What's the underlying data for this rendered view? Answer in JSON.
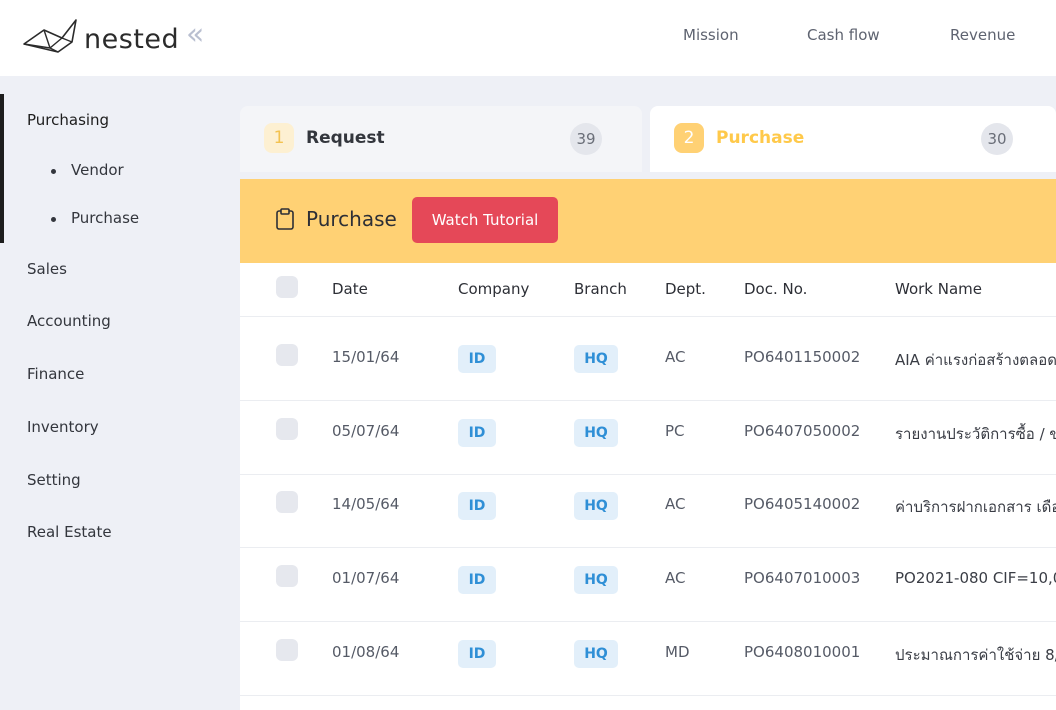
{
  "header": {
    "logo_text": "nested",
    "nav": [
      "Mission",
      "Cash flow",
      "Revenue"
    ]
  },
  "sidebar": {
    "items": [
      {
        "label": "Purchasing",
        "sub": [
          "Vendor",
          "Purchase"
        ]
      },
      {
        "label": "Sales"
      },
      {
        "label": "Accounting"
      },
      {
        "label": "Finance"
      },
      {
        "label": "Inventory"
      },
      {
        "label": "Setting"
      },
      {
        "label": "Real Estate"
      }
    ]
  },
  "tabs": [
    {
      "num": "1",
      "label": "Request",
      "count": "39"
    },
    {
      "num": "2",
      "label": "Purchase",
      "count": "30"
    }
  ],
  "panel": {
    "title": "Purchase",
    "tutorial_label": "Watch Tutorial"
  },
  "table": {
    "columns": [
      "Date",
      "Company",
      "Branch",
      "Dept.",
      "Doc. No.",
      "Work Name"
    ],
    "rows": [
      {
        "date": "15/01/64",
        "company": "ID",
        "branch": "HQ",
        "dept": "AC",
        "doc": "PO6401150002",
        "work": "AIA ค่าแรงก่อสร้างตลอด"
      },
      {
        "date": "05/07/64",
        "company": "ID",
        "branch": "HQ",
        "dept": "PC",
        "doc": "PO6407050002",
        "work": "รายงานประวัติการซื้อ / ข"
      },
      {
        "date": "14/05/64",
        "company": "ID",
        "branch": "HQ",
        "dept": "AC",
        "doc": "PO6405140002",
        "work": "ค่าบริการฝากเอกสาร เดือ"
      },
      {
        "date": "01/07/64",
        "company": "ID",
        "branch": "HQ",
        "dept": "AC",
        "doc": "PO6407010003",
        "work": "PO2021-080 CIF=10,0"
      },
      {
        "date": "01/08/64",
        "company": "ID",
        "branch": "HQ",
        "dept": "MD",
        "doc": "PO6408010001",
        "work": "ประมาณการค่าใช้จ่าย 8/2"
      }
    ]
  },
  "colors": {
    "accent_yellow": "#ffd174",
    "tutorial_red": "#e54858",
    "badge_blue": "#2f8fd6"
  }
}
